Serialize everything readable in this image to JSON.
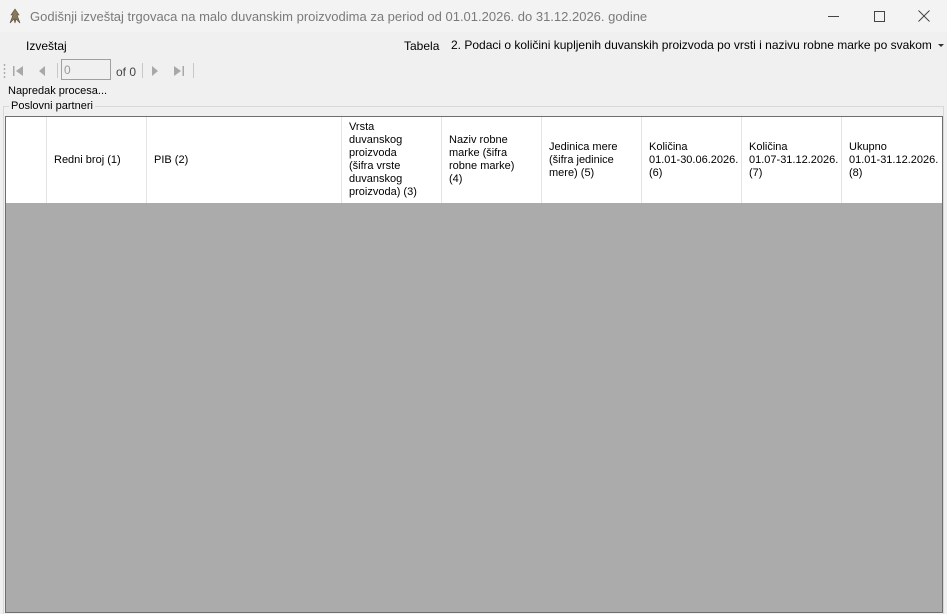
{
  "window": {
    "title": "Godišnji izveštaj trgovaca na malo duvanskim proizvodima za period od 01.01.2026. do 31.12.2026. godine"
  },
  "menu": {
    "izvestaj": "Izveštaj",
    "tabela_label": "Tabela",
    "tabela_value": "2. Podaci o količini kupljenih duvanskih proizvoda po vrsti i nazivu robne marke po svakom"
  },
  "navigator": {
    "page_value": "0",
    "of_text": "of 0"
  },
  "progress_label": "Napredak procesa...",
  "group_title": "Poslovni partneri",
  "grid": {
    "columns": [
      "Redni broj (1)",
      "PIB (2)",
      "Vrsta\nduvanskog\nproizvoda\n(šifra vrste\nduvanskog\nproizvoda) (3)",
      "Naziv robne\nmarke (šifra\nrobne marke)\n(4)",
      "Jedinica mere\n(šifra jedinice\nmere) (5)",
      "Količina\n01.01-30.06.2026.\n(6)",
      "Količina\n01.07-31.12.2026.\n(7)",
      "Ukupno\n01.01-31.12.2026.\n(8)"
    ]
  }
}
